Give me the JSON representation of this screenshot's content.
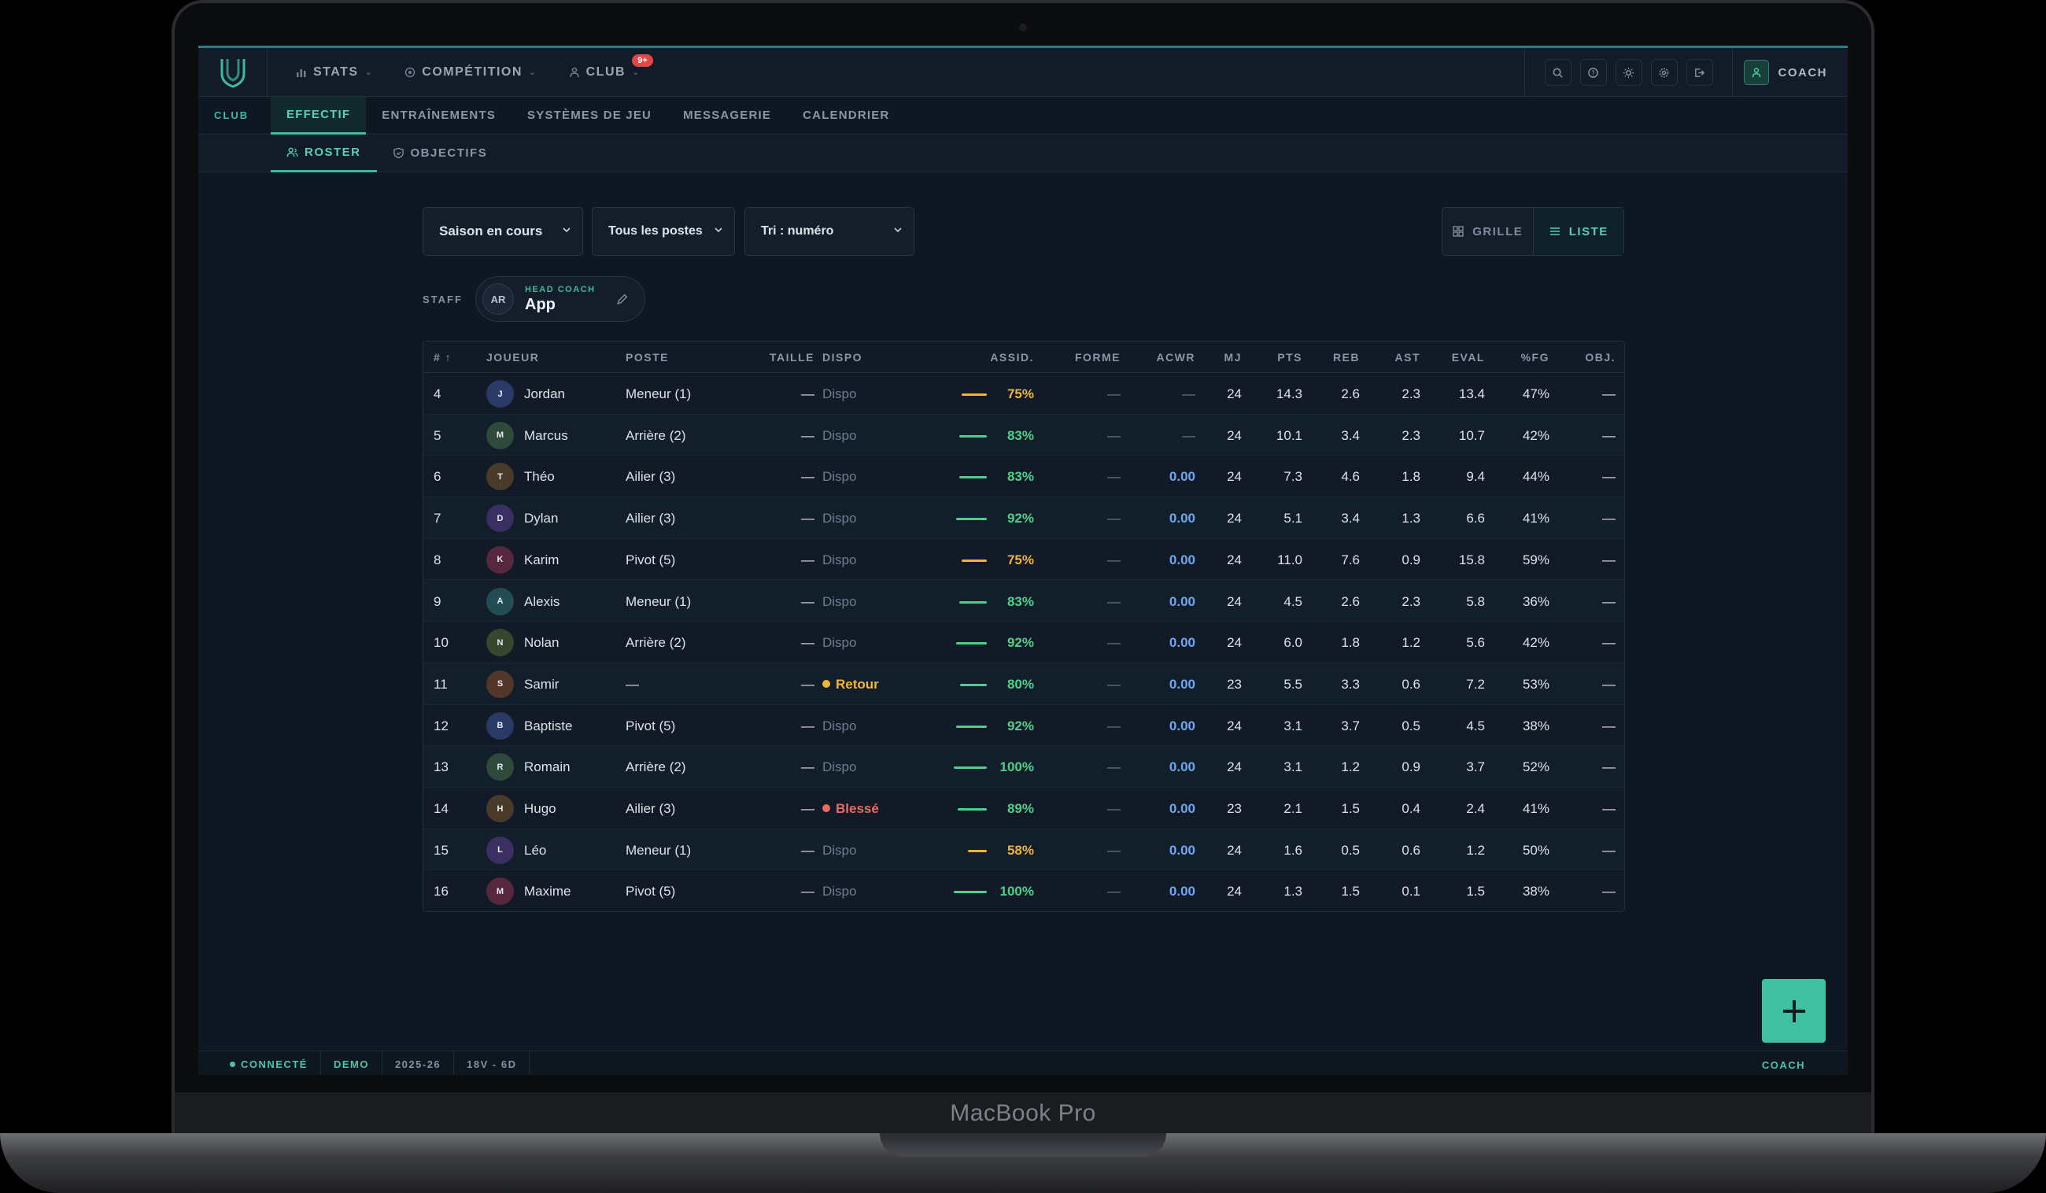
{
  "device": {
    "brand": "MacBook Pro"
  },
  "topbar": {
    "nav": [
      {
        "label": "STATS",
        "icon": "bar-chart-icon"
      },
      {
        "label": "COMPÉTITION",
        "icon": "target-icon"
      },
      {
        "label": "CLUB",
        "icon": "user-group-icon",
        "badge": "9+"
      }
    ],
    "tools": [
      "search-icon",
      "help-icon",
      "sun-icon",
      "gear-icon",
      "logout-icon"
    ],
    "user_label": "COACH"
  },
  "subnav": {
    "section": "CLUB",
    "items": [
      "EFFECTIF",
      "ENTRAÎNEMENTS",
      "SYSTÈMES DE JEU",
      "MESSAGERIE",
      "CALENDRIER"
    ],
    "active": "EFFECTIF"
  },
  "subnav2": {
    "items": [
      "ROSTER",
      "OBJECTIFS"
    ],
    "active": "ROSTER"
  },
  "filters": {
    "season": "Saison en cours",
    "position": "Tous les postes",
    "sort": "Tri : numéro"
  },
  "view": {
    "grid": "GRILLE",
    "list": "LISTE",
    "active": "LISTE"
  },
  "staff": {
    "label": "STAFF",
    "initials": "AR",
    "role": "HEAD COACH",
    "name": "App"
  },
  "table": {
    "headers": {
      "num": "# ↑",
      "player": "JOUEUR",
      "pos": "POSTE",
      "height": "TAILLE",
      "dispo": "DISPO",
      "assid": "ASSID.",
      "forme": "FORME",
      "acwr": "ACWR",
      "mj": "MJ",
      "pts": "PTS",
      "reb": "REB",
      "ast": "AST",
      "eval": "EVAL",
      "fg": "%FG",
      "obj": "OBJ."
    },
    "rows": [
      {
        "num": "4",
        "initial": "J",
        "name": "Jordan",
        "pos": "Meneur (1)",
        "height": "—",
        "dispo": "Dispo",
        "assid": "75%",
        "forme": "—",
        "acwr": "—",
        "mj": "24",
        "pts": "14.3",
        "reb": "2.6",
        "ast": "2.3",
        "eval": "13.4",
        "fg": "47%",
        "obj": "—"
      },
      {
        "num": "5",
        "initial": "M",
        "name": "Marcus",
        "pos": "Arrière (2)",
        "height": "—",
        "dispo": "Dispo",
        "assid": "83%",
        "forme": "—",
        "acwr": "—",
        "mj": "24",
        "pts": "10.1",
        "reb": "3.4",
        "ast": "2.3",
        "eval": "10.7",
        "fg": "42%",
        "obj": "—"
      },
      {
        "num": "6",
        "initial": "T",
        "name": "Théo",
        "pos": "Ailier (3)",
        "height": "—",
        "dispo": "Dispo",
        "assid": "83%",
        "forme": "—",
        "acwr": "0.00",
        "mj": "24",
        "pts": "7.3",
        "reb": "4.6",
        "ast": "1.8",
        "eval": "9.4",
        "fg": "44%",
        "obj": "—"
      },
      {
        "num": "7",
        "initial": "D",
        "name": "Dylan",
        "pos": "Ailier (3)",
        "height": "—",
        "dispo": "Dispo",
        "assid": "92%",
        "forme": "—",
        "acwr": "0.00",
        "mj": "24",
        "pts": "5.1",
        "reb": "3.4",
        "ast": "1.3",
        "eval": "6.6",
        "fg": "41%",
        "obj": "—"
      },
      {
        "num": "8",
        "initial": "K",
        "name": "Karim",
        "pos": "Pivot (5)",
        "height": "—",
        "dispo": "Dispo",
        "assid": "75%",
        "forme": "—",
        "acwr": "0.00",
        "mj": "24",
        "pts": "11.0",
        "reb": "7.6",
        "ast": "0.9",
        "eval": "15.8",
        "fg": "59%",
        "obj": "—"
      },
      {
        "num": "9",
        "initial": "A",
        "name": "Alexis",
        "pos": "Meneur (1)",
        "height": "—",
        "dispo": "Dispo",
        "assid": "83%",
        "forme": "—",
        "acwr": "0.00",
        "mj": "24",
        "pts": "4.5",
        "reb": "2.6",
        "ast": "2.3",
        "eval": "5.8",
        "fg": "36%",
        "obj": "—"
      },
      {
        "num": "10",
        "initial": "N",
        "name": "Nolan",
        "pos": "Arrière (2)",
        "height": "—",
        "dispo": "Dispo",
        "assid": "92%",
        "forme": "—",
        "acwr": "0.00",
        "mj": "24",
        "pts": "6.0",
        "reb": "1.8",
        "ast": "1.2",
        "eval": "5.6",
        "fg": "42%",
        "obj": "—"
      },
      {
        "num": "11",
        "initial": "S",
        "name": "Samir",
        "pos": "—",
        "height": "—",
        "dispo": "Retour",
        "assid": "80%",
        "forme": "—",
        "acwr": "0.00",
        "mj": "23",
        "pts": "5.5",
        "reb": "3.3",
        "ast": "0.6",
        "eval": "7.2",
        "fg": "53%",
        "obj": "—"
      },
      {
        "num": "12",
        "initial": "B",
        "name": "Baptiste",
        "pos": "Pivot (5)",
        "height": "—",
        "dispo": "Dispo",
        "assid": "92%",
        "forme": "—",
        "acwr": "0.00",
        "mj": "24",
        "pts": "3.1",
        "reb": "3.7",
        "ast": "0.5",
        "eval": "4.5",
        "fg": "38%",
        "obj": "—"
      },
      {
        "num": "13",
        "initial": "R",
        "name": "Romain",
        "pos": "Arrière (2)",
        "height": "—",
        "dispo": "Dispo",
        "assid": "100%",
        "forme": "—",
        "acwr": "0.00",
        "mj": "24",
        "pts": "3.1",
        "reb": "1.2",
        "ast": "0.9",
        "eval": "3.7",
        "fg": "52%",
        "obj": "—"
      },
      {
        "num": "14",
        "initial": "H",
        "name": "Hugo",
        "pos": "Ailier (3)",
        "height": "—",
        "dispo": "Blessé",
        "assid": "89%",
        "forme": "—",
        "acwr": "0.00",
        "mj": "23",
        "pts": "2.1",
        "reb": "1.5",
        "ast": "0.4",
        "eval": "2.4",
        "fg": "41%",
        "obj": "—"
      },
      {
        "num": "15",
        "initial": "L",
        "name": "Léo",
        "pos": "Meneur (1)",
        "height": "—",
        "dispo": "Dispo",
        "assid": "58%",
        "forme": "—",
        "acwr": "0.00",
        "mj": "24",
        "pts": "1.6",
        "reb": "0.5",
        "ast": "0.6",
        "eval": "1.2",
        "fg": "50%",
        "obj": "—"
      },
      {
        "num": "16",
        "initial": "M",
        "name": "Maxime",
        "pos": "Pivot (5)",
        "height": "—",
        "dispo": "Dispo",
        "assid": "100%",
        "forme": "—",
        "acwr": "0.00",
        "mj": "24",
        "pts": "1.3",
        "reb": "1.5",
        "ast": "0.1",
        "eval": "1.5",
        "fg": "38%",
        "obj": "—"
      }
    ]
  },
  "colors": {
    "accent": "#3fb9a0",
    "good": "#4fd08a",
    "warn": "#f0b43a",
    "danger": "#ee6a5e",
    "acwr": "#6ea8f2",
    "avatars": [
      "#2a3a66",
      "#2f4a3c",
      "#4a3a2a",
      "#3a2f63",
      "#56283d",
      "#244c55",
      "#35482e",
      "#523629"
    ]
  },
  "statusbar": {
    "connected": "CONNECTÉ",
    "mode": "DEMO",
    "season": "2025-26",
    "record": "18V - 6D",
    "role": "COACH"
  }
}
